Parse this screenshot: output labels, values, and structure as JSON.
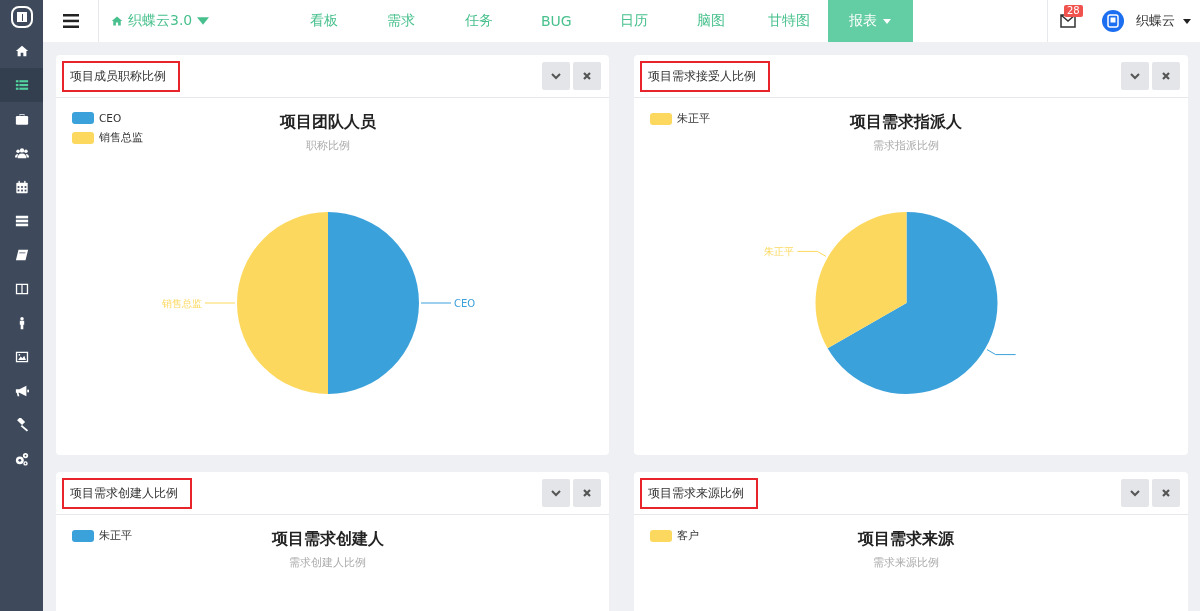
{
  "sidebar": {
    "items": [
      {
        "selected": false
      },
      {
        "selected": true
      },
      {
        "selected": false
      },
      {
        "selected": false
      },
      {
        "selected": false
      },
      {
        "selected": false
      },
      {
        "selected": false
      },
      {
        "selected": false
      },
      {
        "selected": false
      },
      {
        "selected": false
      },
      {
        "selected": false
      },
      {
        "selected": false
      },
      {
        "selected": false
      }
    ]
  },
  "topbar": {
    "project": "织蝶云3.0",
    "nav": [
      {
        "label": "看板",
        "selected": false,
        "dropdown": false
      },
      {
        "label": "需求",
        "selected": false,
        "dropdown": false
      },
      {
        "label": "任务",
        "selected": false,
        "dropdown": false
      },
      {
        "label": "BUG",
        "selected": false,
        "dropdown": false
      },
      {
        "label": "日历",
        "selected": false,
        "dropdown": false
      },
      {
        "label": "脑图",
        "selected": false,
        "dropdown": false
      },
      {
        "label": "甘特图",
        "selected": false,
        "dropdown": false
      },
      {
        "label": "报表",
        "selected": true,
        "dropdown": true
      }
    ],
    "notifications": "28",
    "user": "织蝶云"
  },
  "panels": [
    {
      "heading": "项目成员职称比例",
      "highlighted": true,
      "legend": [
        {
          "label": "CEO",
          "color": "#3ba1da"
        },
        {
          "label": "销售总监",
          "color": "#fdd85e"
        }
      ],
      "chart_title": "项目团队人员",
      "chart_subtitle": "职称比例",
      "chart_data": {
        "type": "pie",
        "categories": [
          "CEO",
          "销售总监"
        ],
        "values": [
          50,
          50
        ],
        "colors": [
          "#3ba1da",
          "#fdd85e"
        ]
      }
    },
    {
      "heading": "项目需求接受人比例",
      "highlighted": true,
      "legend": [
        {
          "label": "朱正平",
          "color": "#fdd85e"
        }
      ],
      "chart_title": "项目需求指派人",
      "chart_subtitle": "需求指派比例",
      "chart_data": {
        "type": "pie",
        "categories": [
          null,
          "朱正平"
        ],
        "values": [
          66.7,
          33.3
        ],
        "colors": [
          "#3ba1da",
          "#fdd85e"
        ]
      }
    },
    {
      "heading": "项目需求创建人比例",
      "highlighted": true,
      "legend": [
        {
          "label": "朱正平",
          "color": "#3ba1da"
        }
      ],
      "chart_title": "项目需求创建人",
      "chart_subtitle": "需求创建人比例"
    },
    {
      "heading": "项目需求来源比例",
      "highlighted": true,
      "legend": [
        {
          "label": "客户",
          "color": "#fdd85e"
        }
      ],
      "chart_title": "项目需求来源",
      "chart_subtitle": "需求来源比例"
    }
  ]
}
